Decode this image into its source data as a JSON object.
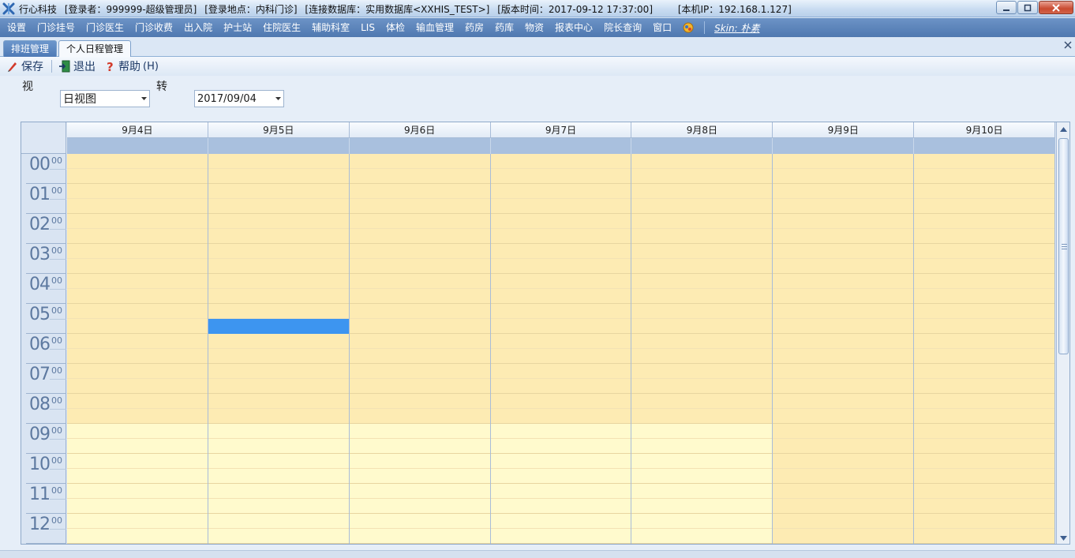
{
  "window": {
    "app_name": "行心科技",
    "login_user": "[登录者：999999-超级管理员]",
    "login_place": "[登录地点：内科门诊]",
    "database": "[连接数据库：实用数据库<XXHIS_TEST>]",
    "version_time": "[版本时间：2017-09-12 17:37:00]",
    "ip": "[本机IP：192.168.1.127]"
  },
  "menu": {
    "items": [
      "设置",
      "门诊挂号",
      "门诊医生",
      "门诊收费",
      "出入院",
      "护士站",
      "住院医生",
      "辅助科室",
      "LIS",
      "体检",
      "输血管理",
      "药房",
      "药库",
      "物资",
      "报表中心",
      "院长查询",
      "窗口"
    ],
    "skin_label": "Skin: 朴素"
  },
  "tabs": [
    {
      "label": "排班管理",
      "active": false
    },
    {
      "label": "个人日程管理",
      "active": true
    }
  ],
  "toolbar": {
    "save_label": "保存",
    "exit_label": "退出",
    "help_label": "帮助",
    "help_shortcut": "(H)"
  },
  "view_selector": {
    "label": "视",
    "value": "日视图"
  },
  "goto_selector": {
    "label": "转",
    "value": "2017/09/04"
  },
  "scheduler": {
    "days": [
      "9月4日",
      "9月5日",
      "9月6日",
      "9月7日",
      "9月8日",
      "9月9日",
      "9月10日"
    ],
    "hours": [
      "00",
      "01",
      "02",
      "03",
      "04",
      "05",
      "06",
      "07",
      "08",
      "09",
      "10",
      "11",
      "12"
    ],
    "minutes_label": "00",
    "work_start_hour": 9,
    "weekend_days": [
      5,
      6
    ],
    "selected_day_index": 1,
    "selected_slot_hour": 5.5,
    "colors": {
      "offhours": "#fdebb3",
      "workhours": "#fffacd",
      "selection": "#3d95f0"
    }
  }
}
